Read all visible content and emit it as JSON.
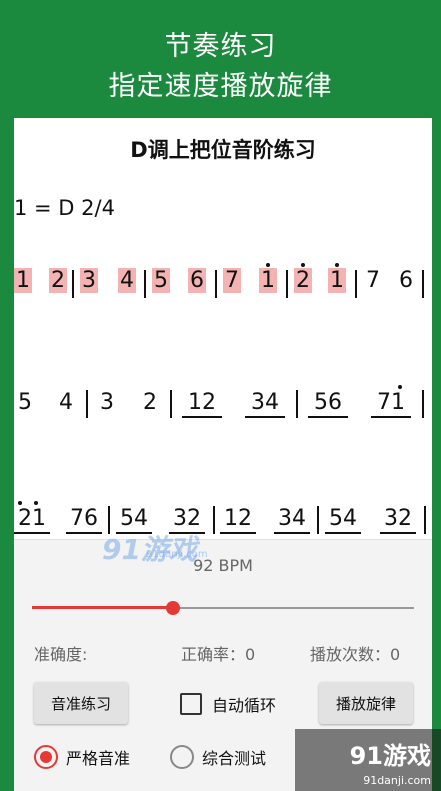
{
  "promo": {
    "line1": "节奏练习",
    "line2": "指定速度播放旋律"
  },
  "sheet": {
    "title": "D调上把位音阶练习",
    "key_signature": "1 = D  2/4",
    "rows": [
      {
        "tokens": [
          "1",
          "2",
          "3",
          "4",
          "5",
          "6",
          "7",
          "1",
          "2",
          "1",
          "7",
          "6"
        ],
        "highlighted": [
          0,
          1,
          2,
          3,
          4,
          5,
          6,
          7,
          8,
          9
        ],
        "dotted": [
          7,
          8,
          9
        ]
      },
      {
        "tokens": [
          "5",
          "4",
          "3",
          "2",
          "12",
          "34",
          "56",
          "71"
        ],
        "underlined": [
          4,
          5,
          6,
          7
        ],
        "dotted_group": 7
      },
      {
        "tokens": [
          "21",
          "76",
          "54",
          "32",
          "12",
          "34",
          "54",
          "32"
        ],
        "underlined": [
          0,
          1,
          2,
          3,
          4,
          5,
          6,
          7
        ],
        "dotted_group": 0
      }
    ]
  },
  "panel": {
    "bpm_label": "92 BPM",
    "tempo_fraction": 0.37,
    "accuracy_label": "准确度:",
    "correct_rate": "正确率：0",
    "play_count": "播放次数：0",
    "pitch_practice_button": "音准练习",
    "auto_loop_label": "自动循环",
    "auto_loop_checked": false,
    "play_melody_button": "播放旋律",
    "mode_strict": "严格音准",
    "mode_combined": "综合测试",
    "selected_mode": "strict"
  },
  "watermark": {
    "center": "91游戏",
    "center_sub": "91danji.com",
    "corner": "91游戏",
    "corner_sub": "91danji.com"
  },
  "colors": {
    "background": "#1b8a3e",
    "accent": "#e53935",
    "highlight": "#f4b3b3"
  }
}
